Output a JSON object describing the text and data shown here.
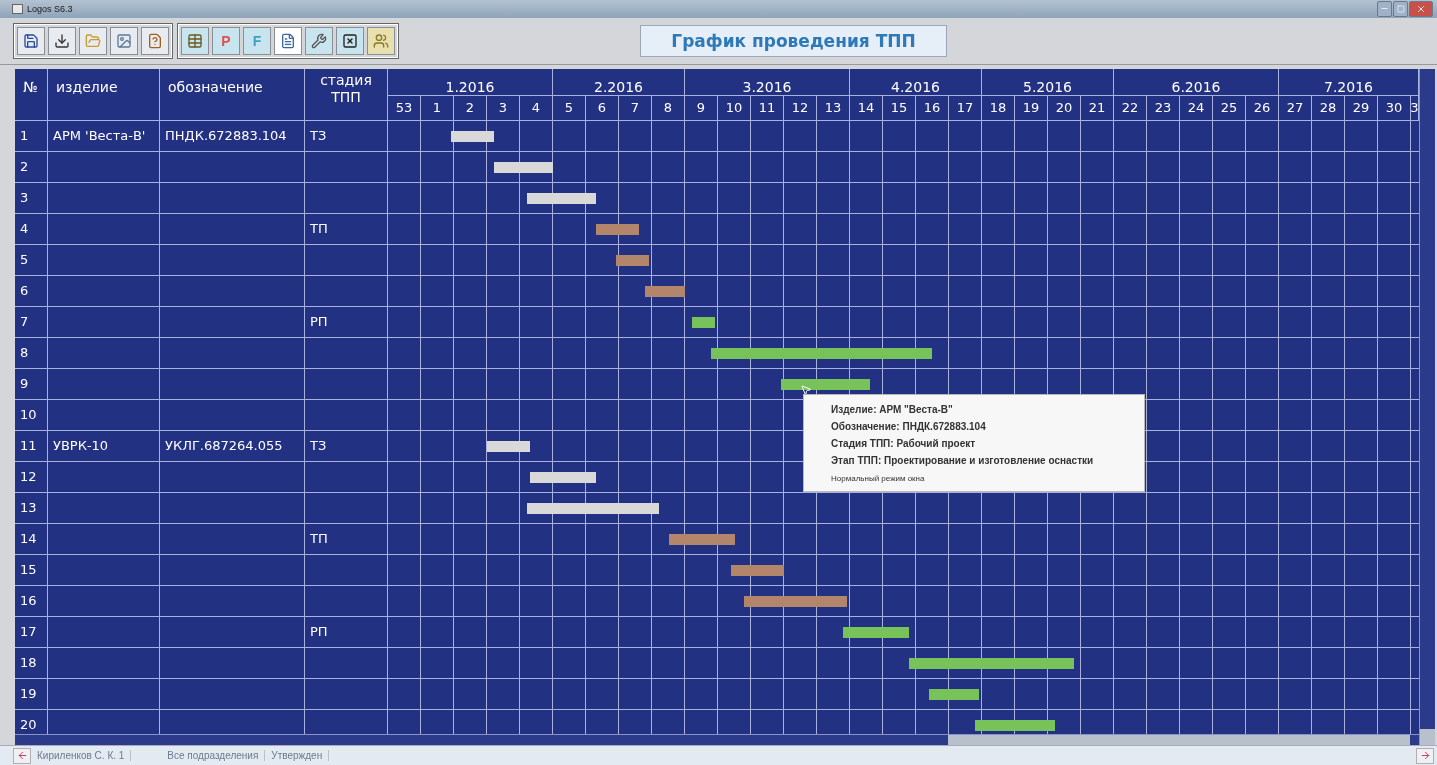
{
  "window": {
    "title": "Logos S6.3"
  },
  "toolbar": {
    "letter_buttons": [
      {
        "label": "P"
      },
      {
        "label": "F"
      }
    ]
  },
  "view_title": "График проведения ТПП",
  "table": {
    "columns": [
      "№",
      "изделие",
      "обозначение",
      "стадия ТПП"
    ],
    "months": [
      {
        "label": "1.2016",
        "weeks": [
          "53",
          "1",
          "2",
          "3",
          "4"
        ]
      },
      {
        "label": "2.2016",
        "weeks": [
          "5",
          "6",
          "7",
          "8"
        ]
      },
      {
        "label": "3.2016",
        "weeks": [
          "9",
          "10",
          "11",
          "12",
          "13"
        ]
      },
      {
        "label": "4.2016",
        "weeks": [
          "14",
          "15",
          "16",
          "17"
        ]
      },
      {
        "label": "5.2016",
        "weeks": [
          "18",
          "19",
          "20",
          "21"
        ]
      },
      {
        "label": "6.2016",
        "weeks": [
          "22",
          "23",
          "24",
          "25",
          "26"
        ]
      },
      {
        "label": "7.2016",
        "weeks": [
          "27",
          "28",
          "29",
          "30",
          "3"
        ]
      }
    ],
    "rows": [
      {
        "no": "1",
        "product": "АРМ 'Веста-В'",
        "code": "ПНДК.672883.104",
        "stage": "ТЗ",
        "bar": {
          "kind": "tz"
        }
      },
      {
        "no": "2",
        "bar": {
          "kind": "tz"
        }
      },
      {
        "no": "3",
        "bar": {
          "kind": "tz"
        }
      },
      {
        "no": "4",
        "stage": "ТП",
        "bar": {
          "kind": "tp"
        }
      },
      {
        "no": "5",
        "bar": {
          "kind": "tp"
        }
      },
      {
        "no": "6",
        "bar": {
          "kind": "tp"
        }
      },
      {
        "no": "7",
        "stage": "РП",
        "bar": {
          "kind": "rp"
        }
      },
      {
        "no": "8",
        "bar": {
          "kind": "rp"
        }
      },
      {
        "no": "9",
        "bar": {
          "kind": "rp"
        }
      },
      {
        "no": "10"
      },
      {
        "no": "11",
        "product": "УВРК-10",
        "code": "УКЛГ.687264.055",
        "stage": "ТЗ",
        "bar": {
          "kind": "tz"
        }
      },
      {
        "no": "12",
        "bar": {
          "kind": "tz"
        }
      },
      {
        "no": "13",
        "bar": {
          "kind": "tz"
        }
      },
      {
        "no": "14",
        "stage": "ТП",
        "bar": {
          "kind": "tp"
        }
      },
      {
        "no": "15",
        "bar": {
          "kind": "tp"
        }
      },
      {
        "no": "16",
        "bar": {
          "kind": "tp"
        }
      },
      {
        "no": "17",
        "stage": "РП",
        "bar": {
          "kind": "rp"
        }
      },
      {
        "no": "18",
        "bar": {
          "kind": "rp"
        }
      },
      {
        "no": "19",
        "bar": {
          "kind": "rp"
        }
      },
      {
        "no": "20",
        "bar": {
          "kind": "rp"
        }
      }
    ]
  },
  "tooltip": {
    "lines": [
      "Изделие: АРМ \"Веста-В\"",
      "Обозначение: ПНДК.672883.104",
      "Стадия ТПП: Рабочий проект",
      "Этап ТПП: Проектирование и изготовление оснастки"
    ],
    "footer": "Нормальный режим окна"
  },
  "status_bar": {
    "user": "Кириленков С. К. 1",
    "department": "Все подразделения",
    "state": "Утвержден"
  }
}
